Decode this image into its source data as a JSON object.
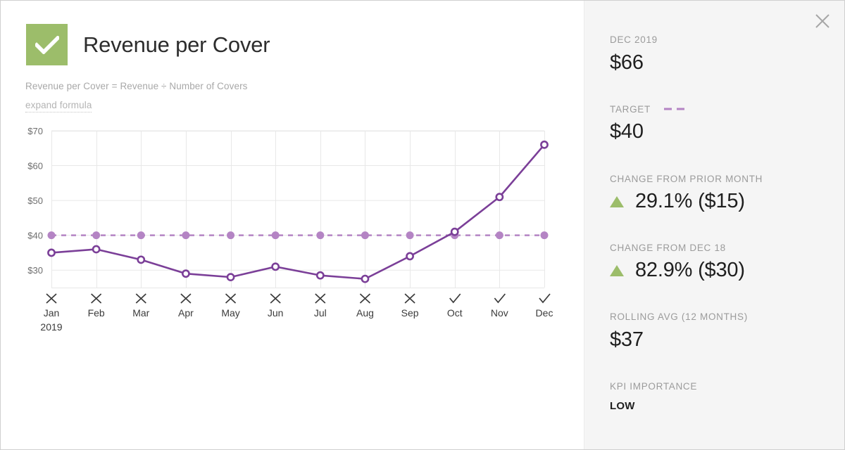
{
  "header": {
    "title": "Revenue per Cover",
    "status_icon": "check-icon",
    "status_color": "#9cbd6a",
    "formula": "Revenue per Cover = Revenue ÷ Number of Covers",
    "expand_link": "expand formula"
  },
  "sidebar": {
    "close_icon": "close-icon",
    "stats": [
      {
        "label": "DEC 2019",
        "value": "$66"
      },
      {
        "label": "TARGET",
        "value": "$40",
        "legend": "dashed-line-swatch"
      },
      {
        "label": "CHANGE FROM PRIOR MONTH",
        "value": "29.1% ($15)",
        "direction": "up",
        "direction_icon": "triangle-up-icon"
      },
      {
        "label": "CHANGE FROM DEC 18",
        "value": "82.9% ($30)",
        "direction": "up",
        "direction_icon": "triangle-up-icon"
      },
      {
        "label": "ROLLING AVG (12 MONTHS)",
        "value": "$37"
      },
      {
        "label": "KPI IMPORTANCE",
        "value": "LOW"
      }
    ]
  },
  "colors": {
    "accent_green": "#9cbd6a",
    "line_purple": "#7b3f98",
    "target_purple": "#b484c4",
    "grid_gray": "#e8e8e8",
    "sidebar_bg": "#f5f5f5"
  },
  "chart_data": {
    "type": "line",
    "title": "Revenue per Cover",
    "xlabel": "",
    "ylabel": "",
    "ylim": [
      25,
      70
    ],
    "y_ticks": [
      30,
      40,
      50,
      60,
      70
    ],
    "y_tick_labels": [
      "$30",
      "$40",
      "$50",
      "$60",
      "$70"
    ],
    "categories": [
      "Jan",
      "Feb",
      "Mar",
      "Apr",
      "May",
      "Jun",
      "Jul",
      "Aug",
      "Sep",
      "Oct",
      "Nov",
      "Dec"
    ],
    "x_sublabels": [
      "2019",
      "",
      "",
      "",
      "",
      "",
      "",
      "",
      "",
      "",
      "",
      ""
    ],
    "status_marks": [
      "x",
      "x",
      "x",
      "x",
      "x",
      "x",
      "x",
      "x",
      "x",
      "check",
      "check",
      "check"
    ],
    "grid": true,
    "legend_position": "sidebar",
    "series": [
      {
        "name": "Revenue per Cover",
        "type": "line",
        "color": "#7b3f98",
        "marker": "open-circle",
        "values": [
          35,
          36,
          33,
          29,
          28,
          31,
          28.5,
          27.5,
          34,
          41,
          51,
          66
        ]
      },
      {
        "name": "Target",
        "type": "dashed-line",
        "color": "#b484c4",
        "marker": "filled-circle",
        "values": [
          40,
          40,
          40,
          40,
          40,
          40,
          40,
          40,
          40,
          40,
          40,
          40
        ]
      }
    ]
  }
}
